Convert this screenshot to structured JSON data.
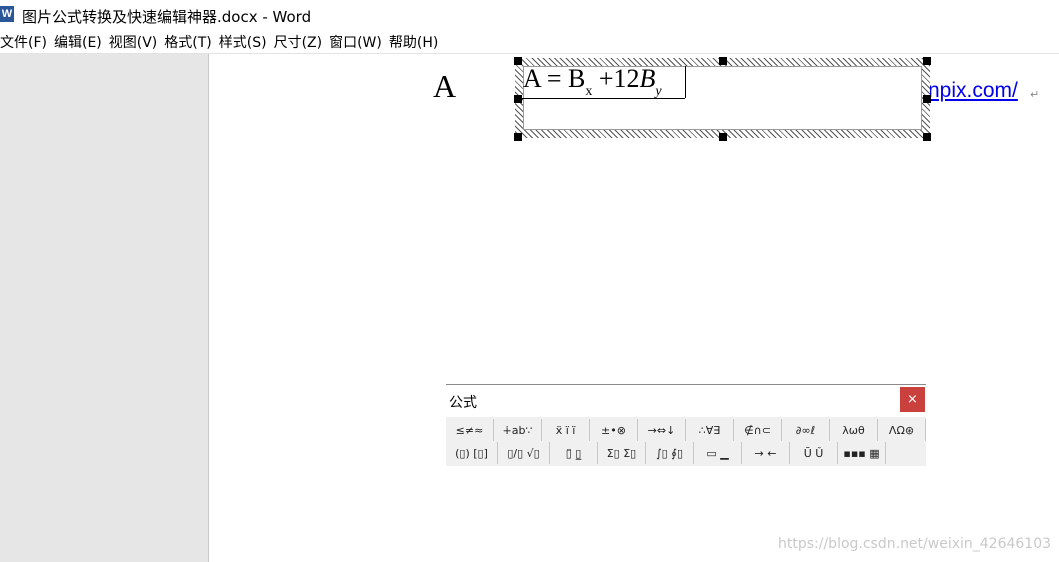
{
  "window": {
    "app_icon_letter": "W",
    "title": "图片公式转换及快速编辑神器.docx - Word"
  },
  "menubar": {
    "items": [
      "文件(F)",
      "编辑(E)",
      "视图(V)",
      "格式(T)",
      "样式(S)",
      "尺寸(Z)",
      "窗口(W)",
      "帮助(H)"
    ]
  },
  "document": {
    "letter": "A",
    "link_text": "npix.com/",
    "para_mark": "↵"
  },
  "equation": {
    "part1": "A = B",
    "sub_x": "x",
    "part2": " +12",
    "var_b": "B",
    "sub_y": "y"
  },
  "palette": {
    "title": "公式",
    "close_label": "×",
    "row1": [
      "≤≠≈",
      "∔ab∵",
      "ẍ ï ï",
      "±•⊗",
      "→⇔↓",
      "∴∀∃",
      "∉∩⊂",
      "∂∞ℓ",
      "λωθ",
      "ΛΩ⊛"
    ],
    "row2": [
      "(▯) [▯]",
      "▯/▯ √▯",
      "▯̈ ▯̲",
      "Σ▯ Σ▯",
      "∫▯ ∮▯",
      "▭ ▁",
      "→ ←",
      "Ū Ǔ",
      "▪▪▪ ▦"
    ]
  },
  "watermark": "https://blog.csdn.net/weixin_42646103"
}
